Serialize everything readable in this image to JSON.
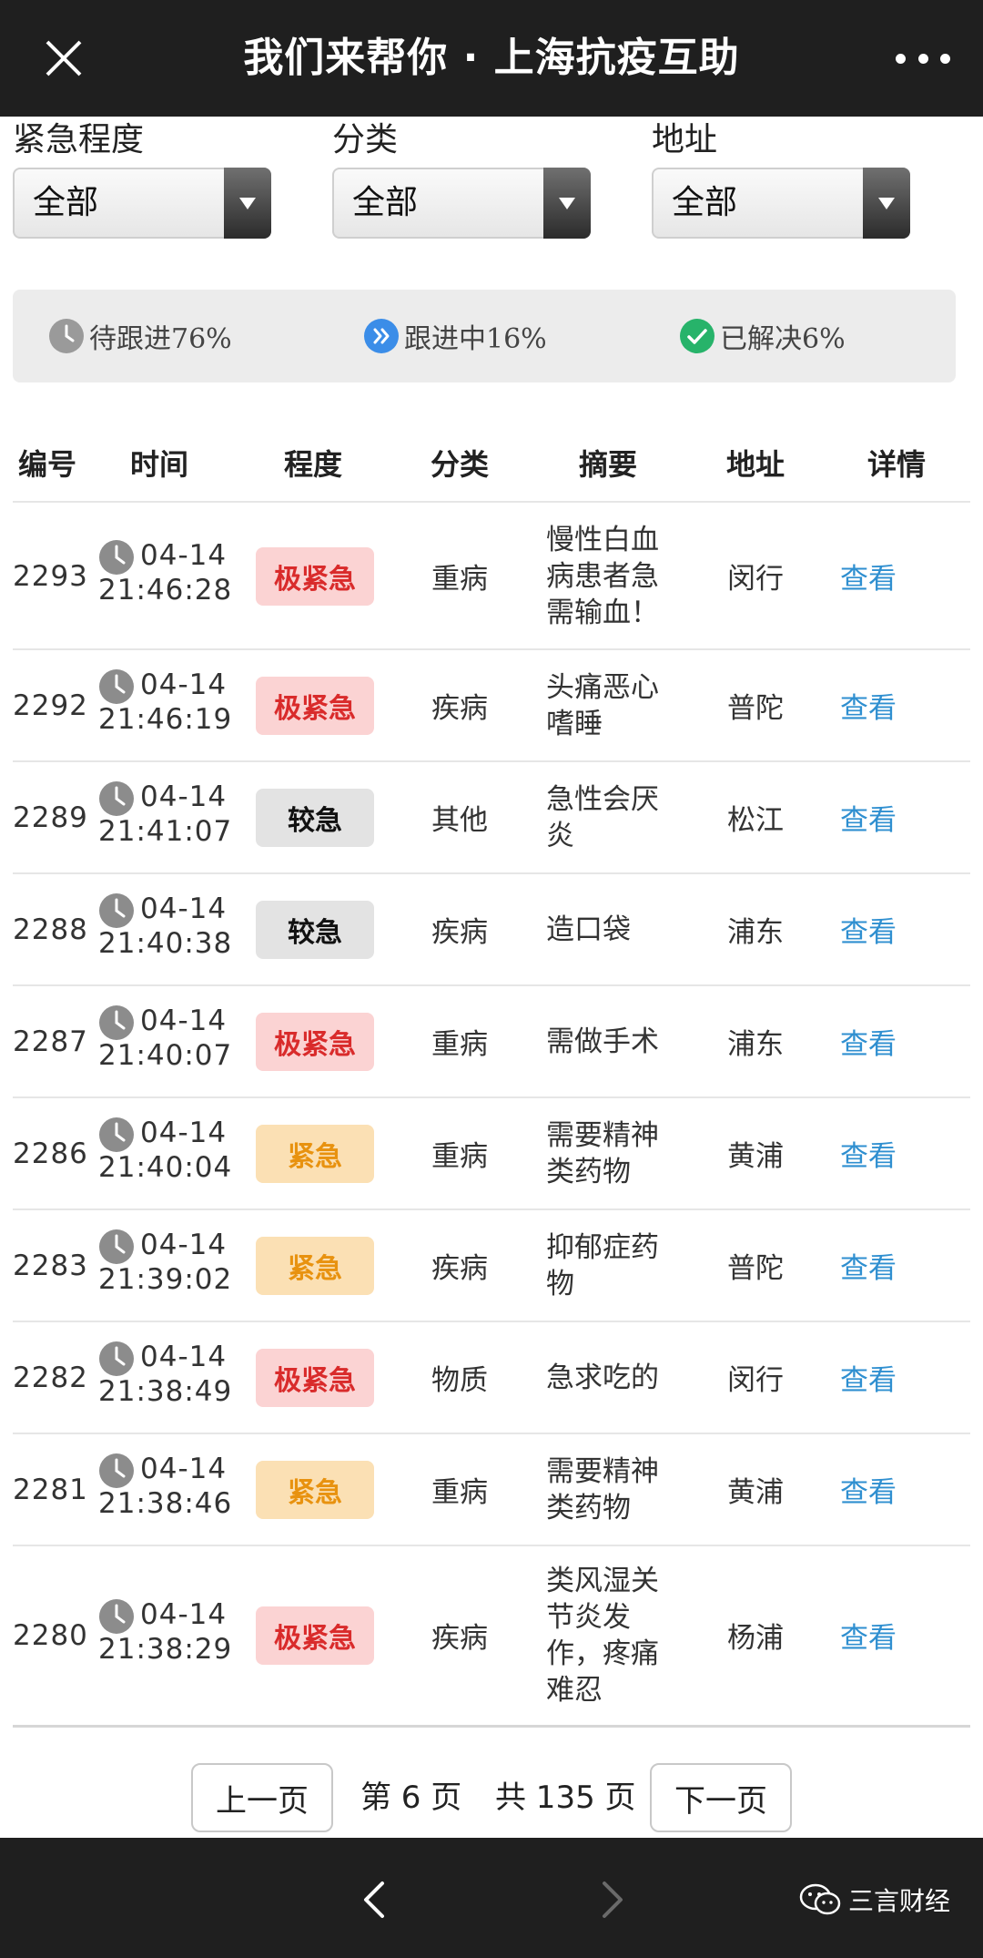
{
  "header": {
    "title": "我们来帮你 · 上海抗疫互助"
  },
  "filters": [
    {
      "label": "紧急程度",
      "value": "全部"
    },
    {
      "label": "分类",
      "value": "全部"
    },
    {
      "label": "地址",
      "value": "全部"
    }
  ],
  "stats": {
    "pending": "待跟进76%",
    "in_progress": "跟进中16%",
    "resolved": "已解决6%"
  },
  "table": {
    "headers": [
      "编号",
      "时间",
      "程度",
      "分类",
      "摘要",
      "地址",
      "详情"
    ],
    "rows": [
      {
        "id": "2293",
        "date": "04-14",
        "time": "21:46:28",
        "level": "极紧急",
        "category": "重病",
        "summary": [
          "慢性白血",
          "病患者急",
          "需输血！"
        ],
        "address": "闵行",
        "detail": "查看"
      },
      {
        "id": "2292",
        "date": "04-14",
        "time": "21:46:19",
        "level": "极紧急",
        "category": "疾病",
        "summary": [
          "头痛恶心",
          "嗜睡"
        ],
        "address": "普陀",
        "detail": "查看"
      },
      {
        "id": "2289",
        "date": "04-14",
        "time": "21:41:07",
        "level": "较急",
        "category": "其他",
        "summary": [
          "急性会厌",
          "炎"
        ],
        "address": "松江",
        "detail": "查看"
      },
      {
        "id": "2288",
        "date": "04-14",
        "time": "21:40:38",
        "level": "较急",
        "category": "疾病",
        "summary": [
          "造口袋"
        ],
        "address": "浦东",
        "detail": "查看"
      },
      {
        "id": "2287",
        "date": "04-14",
        "time": "21:40:07",
        "level": "极紧急",
        "category": "重病",
        "summary": [
          "需做手术"
        ],
        "address": "浦东",
        "detail": "查看"
      },
      {
        "id": "2286",
        "date": "04-14",
        "time": "21:40:04",
        "level": "紧急",
        "category": "重病",
        "summary": [
          "需要精神",
          "类药物"
        ],
        "address": "黄浦",
        "detail": "查看"
      },
      {
        "id": "2283",
        "date": "04-14",
        "time": "21:39:02",
        "level": "紧急",
        "category": "疾病",
        "summary": [
          "抑郁症药",
          "物"
        ],
        "address": "普陀",
        "detail": "查看"
      },
      {
        "id": "2282",
        "date": "04-14",
        "time": "21:38:49",
        "level": "极紧急",
        "category": "物质",
        "summary": [
          "急求吃的"
        ],
        "address": "闵行",
        "detail": "查看"
      },
      {
        "id": "2281",
        "date": "04-14",
        "time": "21:38:46",
        "level": "紧急",
        "category": "重病",
        "summary": [
          "需要精神",
          "类药物"
        ],
        "address": "黄浦",
        "detail": "查看"
      },
      {
        "id": "2280",
        "date": "04-14",
        "time": "21:38:29",
        "level": "极紧急",
        "category": "疾病",
        "summary": [
          "类风湿关",
          "节炎发",
          "作，疼痛",
          "难忍"
        ],
        "address": "杨浦",
        "detail": "查看"
      }
    ]
  },
  "pagination": {
    "prev": "上一页",
    "current": "第 6 页",
    "total": "共 135 页",
    "next": "下一页"
  },
  "footer": {
    "brand": "三言财经"
  },
  "colors": {
    "level_critical_bg": "#fbd3d3",
    "level_critical_text": "#d92b2b",
    "level_urgent_bg": "#fbe0b4",
    "level_urgent_text": "#e8920f",
    "level_moderate_bg": "#e3e3e3",
    "level_moderate_text": "#111111",
    "link": "#2f8fd0",
    "pending_icon": "#9a9a9a",
    "progress_icon": "#3b8de8",
    "resolved_icon": "#27b36a"
  },
  "icons": {
    "close": "close-icon",
    "more": "more-icon",
    "clock": "clock-icon",
    "forward": "double-chevron-icon",
    "check": "check-icon",
    "back_nav": "chevron-left-icon",
    "forward_nav": "chevron-right-icon",
    "wechat": "wechat-icon"
  }
}
